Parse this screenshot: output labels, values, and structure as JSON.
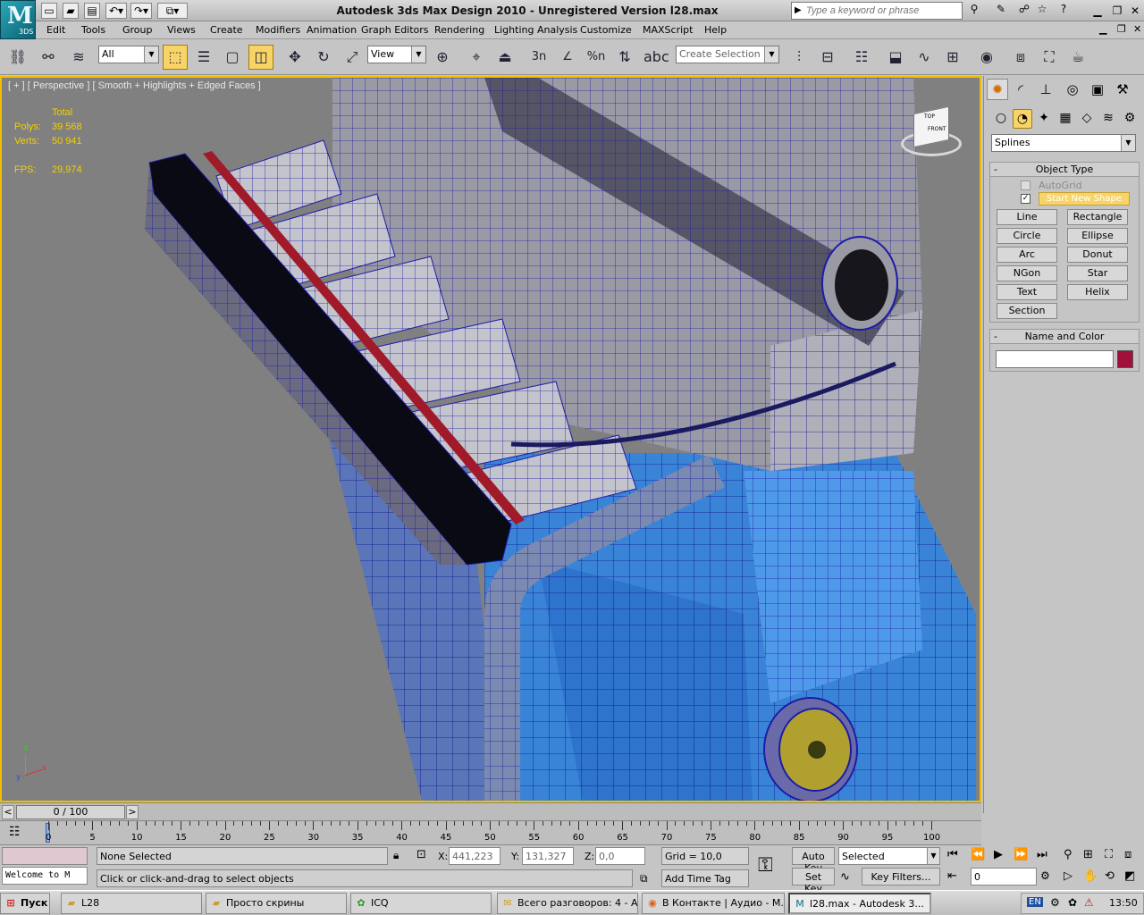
{
  "window": {
    "title": "Autodesk 3ds Max Design 2010  - Unregistered Version    l28.max",
    "logo_text": "3DS"
  },
  "search": {
    "placeholder": "Type a keyword or phrase"
  },
  "menu": [
    "Edit",
    "Tools",
    "Group",
    "Views",
    "Create",
    "Modifiers",
    "Animation",
    "Graph Editors",
    "Rendering",
    "Lighting Analysis",
    "Customize",
    "MAXScript",
    "Help"
  ],
  "toolbar": {
    "filter": "All",
    "ref_coord": "View",
    "selection_set": "Create Selection Se",
    "snap_3": "3",
    "snap_n": "n",
    "snap_pct": "%",
    "snap_n2": "n"
  },
  "viewport": {
    "label": "[ + ] [ Perspective ] [ Smooth + Highlights + Edged Faces ]",
    "stats_header": "Total",
    "polys_label": "Polys:",
    "polys": "39 568",
    "verts_label": "Verts:",
    "verts": "50 941",
    "fps_label": "FPS:",
    "fps": "29,974",
    "viewcube_top": "TOP",
    "viewcube_front": "FRONT",
    "axis_x": "x",
    "axis_y": "y",
    "axis_z": "z"
  },
  "command_panel": {
    "dropdown": "Splines",
    "object_type_title": "Object Type",
    "autogrid": "AutoGrid",
    "start_new_shape": "Start New Shape",
    "buttons": [
      "Line",
      "Rectangle",
      "Circle",
      "Ellipse",
      "Arc",
      "Donut",
      "NGon",
      "Star",
      "Text",
      "Helix",
      "Section"
    ],
    "name_color_title": "Name and Color",
    "name_value": "",
    "color": "#a0103a"
  },
  "timeline": {
    "frame": "0 / 100",
    "ticks": [
      "0",
      "5",
      "10",
      "15",
      "20",
      "25",
      "30",
      "35",
      "40",
      "45",
      "50",
      "55",
      "60",
      "65",
      "70",
      "75",
      "80",
      "85",
      "90",
      "95",
      "100"
    ]
  },
  "status": {
    "welcome": "Welcome to M",
    "selection": "None Selected",
    "prompt": "Click or click-and-drag to select objects",
    "x_label": "X:",
    "x": "441,223",
    "y_label": "Y:",
    "y": "131,327",
    "z_label": "Z:",
    "z": "0,0",
    "grid": "Grid = 10,0",
    "add_time_tag": "Add Time Tag",
    "auto_key": "Auto Key",
    "set_key": "Set Key",
    "selected_combo": "Selected",
    "key_filters": "Key Filters...",
    "frame_field": "0"
  },
  "taskbar": {
    "start": "Пуск",
    "tasks": [
      "L28",
      "Просто скрины",
      "ICQ",
      "Всего разговоров: 4 - А...",
      "В Контакте | Аудио - М...",
      "l28.max - Autodesk 3..."
    ],
    "lang": "EN",
    "clock": "13:50"
  },
  "colors": {
    "viewport_bg": "#808080",
    "stats": "#f2d000",
    "accent": "#f8d468"
  }
}
